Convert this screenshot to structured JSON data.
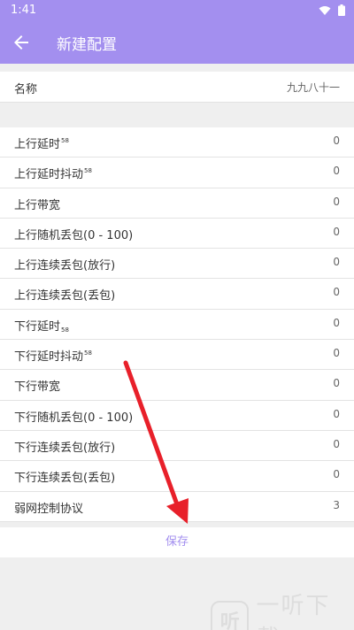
{
  "status": {
    "time": "1:41"
  },
  "appbar": {
    "title": "新建配置",
    "back_icon": "arrow-left-icon"
  },
  "name_row": {
    "label": "名称",
    "value": "九九八十一"
  },
  "settings": [
    {
      "label": "上行延时",
      "mark": "58",
      "mark_type": "sup",
      "value": "0"
    },
    {
      "label": "上行延时抖动",
      "mark": "58",
      "mark_type": "sup",
      "value": "0"
    },
    {
      "label": "上行带宽",
      "mark": "",
      "mark_type": "",
      "value": "0"
    },
    {
      "label": "上行随机丢包(0 - 100)",
      "mark": "",
      "mark_type": "",
      "value": "0"
    },
    {
      "label": "上行连续丢包(放行)",
      "mark": "",
      "mark_type": "",
      "value": "0"
    },
    {
      "label": "上行连续丢包(丢包)",
      "mark": "",
      "mark_type": "",
      "value": "0"
    },
    {
      "label": "下行延时",
      "mark": "58",
      "mark_type": "sub",
      "value": "0"
    },
    {
      "label": "下行延时抖动",
      "mark": "58",
      "mark_type": "sup",
      "value": "0"
    },
    {
      "label": "下行带宽",
      "mark": "",
      "mark_type": "",
      "value": "0"
    },
    {
      "label": "下行随机丢包(0 - 100)",
      "mark": "",
      "mark_type": "",
      "value": "0"
    },
    {
      "label": "下行连续丢包(放行)",
      "mark": "",
      "mark_type": "",
      "value": "0"
    },
    {
      "label": "下行连续丢包(丢包)",
      "mark": "",
      "mark_type": "",
      "value": "0"
    },
    {
      "label": "弱网控制协议",
      "mark": "",
      "mark_type": "",
      "value": "3"
    }
  ],
  "save_label": "保存",
  "watermark": {
    "logo_char": "听",
    "text": "一听下载"
  },
  "colors": {
    "accent": "#a38fef",
    "arrow": "#e8202a"
  }
}
